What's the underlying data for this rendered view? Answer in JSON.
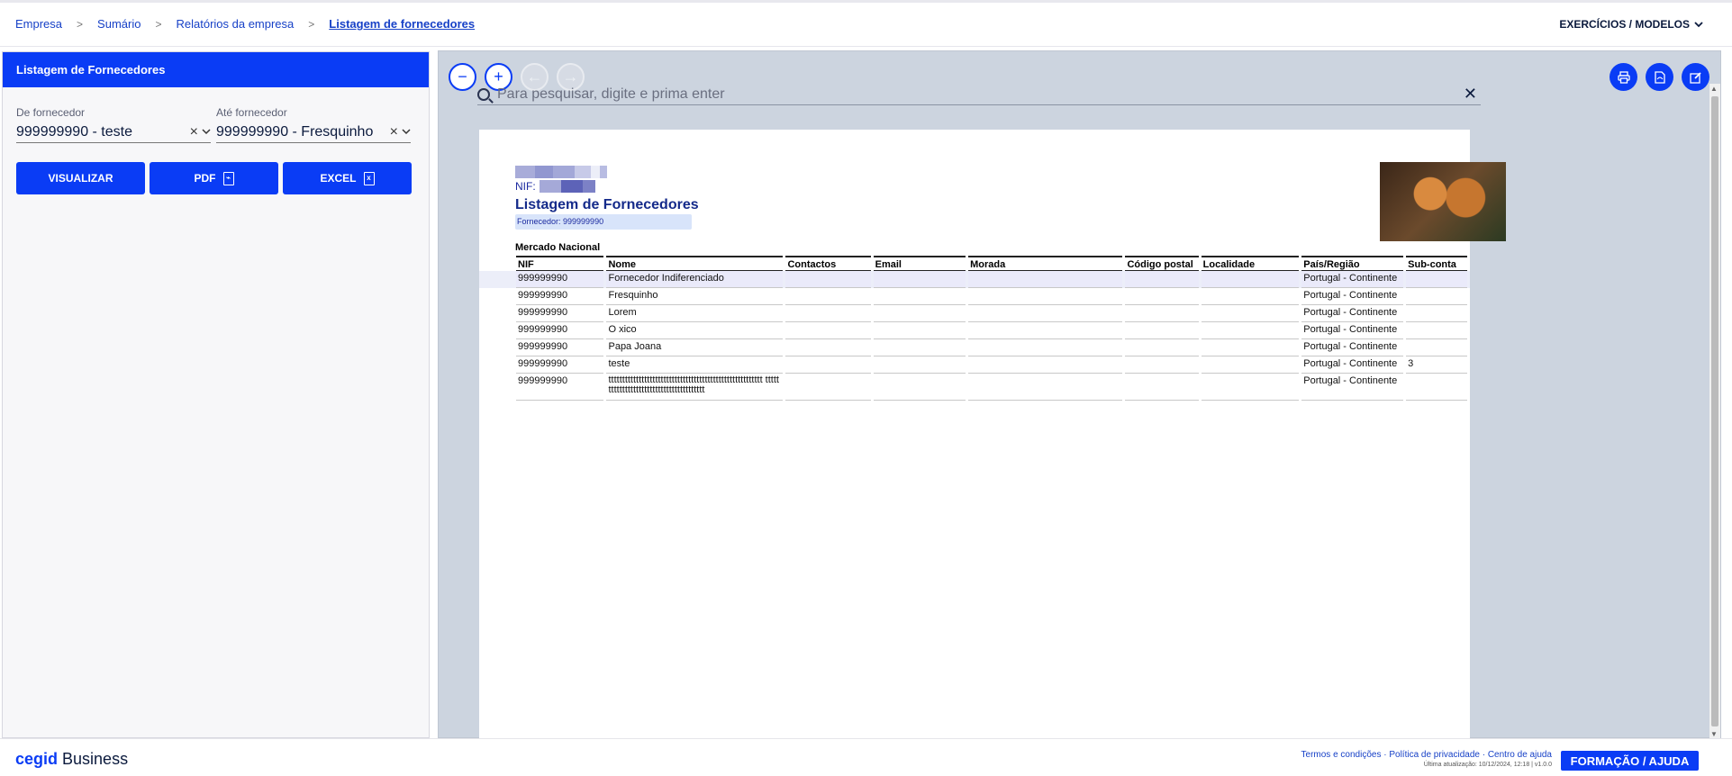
{
  "breadcrumb": [
    "Empresa",
    "Sumário",
    "Relatórios da empresa",
    "Listagem de fornecedores"
  ],
  "header": {
    "exercicios_label": "EXERCÍCIOS / MODELOS"
  },
  "left_panel": {
    "title": "Listagem de Fornecedores",
    "from_label": "De fornecedor",
    "from_value": "999999990 - teste",
    "to_label": "Até fornecedor",
    "to_value": "999999990 - Fresquinho",
    "btn_view": "VISUALIZAR",
    "btn_pdf": "PDF",
    "btn_excel": "EXCEL"
  },
  "viewer": {
    "search_placeholder": "Para pesquisar, digite e prima enter"
  },
  "report": {
    "nif_label": "NIF:",
    "title": "Listagem de Fornecedores",
    "filter": "Fornecedor: 999999990",
    "section": "Mercado Nacional",
    "columns": [
      "NIF",
      "Nome",
      "Contactos",
      "Email",
      "Morada",
      "Código postal",
      "Localidade",
      "País/Região",
      "Sub-conta"
    ],
    "rows": [
      [
        "999999990",
        "Fornecedor Indiferenciado",
        "",
        "",
        "",
        "",
        "",
        "Portugal - Continente",
        ""
      ],
      [
        "999999990",
        "Fresquinho",
        "",
        "",
        "",
        "",
        "",
        "Portugal - Continente",
        ""
      ],
      [
        "999999990",
        "Lorem",
        "",
        "",
        "",
        "",
        "",
        "Portugal - Continente",
        ""
      ],
      [
        "999999990",
        "O xico",
        "",
        "",
        "",
        "",
        "",
        "Portugal - Continente",
        ""
      ],
      [
        "999999990",
        "Papa Joana",
        "",
        "",
        "",
        "",
        "",
        "Portugal - Continente",
        ""
      ],
      [
        "999999990",
        "teste",
        "",
        "",
        "",
        "",
        "",
        "Portugal - Continente",
        "3"
      ],
      [
        "999999990",
        "tttttttttttttttttttttttttttttttttttttttttttttttttttttttt tttttttttttttttttttttttttttttttttttttttt",
        "",
        "",
        "",
        "",
        "",
        "Portugal - Continente",
        ""
      ]
    ]
  },
  "footer": {
    "brand_bold": "cegid",
    "brand_light": "Business",
    "links": "Termos e condições · Política de privacidade · Centro de ajuda",
    "updated": "Última atualização: 10/12/2024, 12:18 | v1.0.0",
    "help_button": "FORMAÇÃO / AJUDA"
  },
  "colors": {
    "accent": "#0a3cf5",
    "viewer_bg": "#ccd4df",
    "report_title": "#142a8a"
  }
}
